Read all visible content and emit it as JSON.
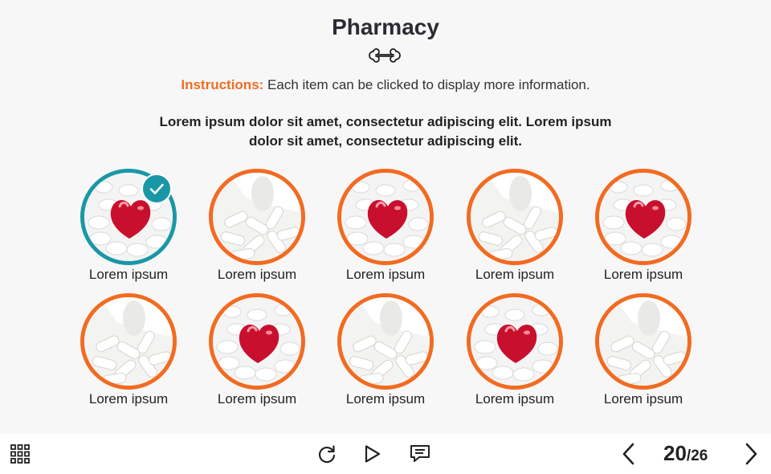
{
  "header": {
    "title": "Pharmacy",
    "instructions_label": "Instructions:",
    "instructions_text": " Each item can be clicked to display more information.",
    "lead": "Lorem ipsum dolor sit amet, consectetur adipiscing elit. Lorem ipsum dolor sit amet, consectetur adipiscing elit."
  },
  "colors": {
    "accent": "#f26b21",
    "visited": "#1a97a6"
  },
  "items": [
    {
      "label": "Lorem ipsum",
      "image": "heart-pills",
      "visited": true
    },
    {
      "label": "Lorem ipsum",
      "image": "capsules-bottle",
      "visited": false
    },
    {
      "label": "Lorem ipsum",
      "image": "heart-pills",
      "visited": false
    },
    {
      "label": "Lorem ipsum",
      "image": "capsules-bottle",
      "visited": false
    },
    {
      "label": "Lorem ipsum",
      "image": "heart-pills",
      "visited": false
    },
    {
      "label": "Lorem ipsum",
      "image": "capsules-bottle",
      "visited": false
    },
    {
      "label": "Lorem ipsum",
      "image": "heart-pills",
      "visited": false
    },
    {
      "label": "Lorem ipsum",
      "image": "capsules-bottle",
      "visited": false
    },
    {
      "label": "Lorem ipsum",
      "image": "heart-pills",
      "visited": false
    },
    {
      "label": "Lorem ipsum",
      "image": "capsules-bottle",
      "visited": false
    }
  ],
  "footer": {
    "menu_icon": "grid-menu-icon",
    "replay_icon": "replay-icon",
    "play_icon": "play-icon",
    "captions_icon": "captions-icon",
    "prev_icon": "chevron-left-icon",
    "next_icon": "chevron-right-icon",
    "current_page": "20",
    "total_pages": "/26"
  }
}
